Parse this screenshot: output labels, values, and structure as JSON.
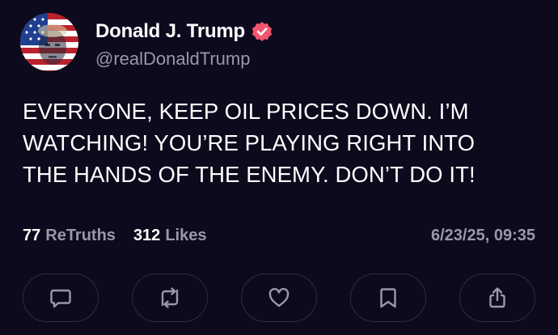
{
  "author": {
    "display_name": "Donald J. Trump",
    "handle": "@realDonaldTrump",
    "verified": true,
    "verified_color": "#f2566f"
  },
  "post": {
    "text": "EVERYONE, KEEP OIL PRICES DOWN. I’M\nWATCHING! YOU’RE PLAYING RIGHT INTO\nTHE HANDS OF THE ENEMY. DON’T DO IT!"
  },
  "stats": {
    "retruths_count": "77",
    "retruths_label": "ReTruths",
    "likes_count": "312",
    "likes_label": "Likes",
    "timestamp": "6/23/25, 09:35"
  },
  "actions": [
    {
      "name": "reply",
      "icon": "comment-icon"
    },
    {
      "name": "retruth",
      "icon": "repost-icon"
    },
    {
      "name": "like",
      "icon": "heart-icon"
    },
    {
      "name": "bookmark",
      "icon": "bookmark-icon"
    },
    {
      "name": "share",
      "icon": "share-icon"
    }
  ],
  "colors": {
    "background": "#0c0a1c",
    "muted_text": "#9a98a8",
    "button_border": "#2e2c44"
  }
}
